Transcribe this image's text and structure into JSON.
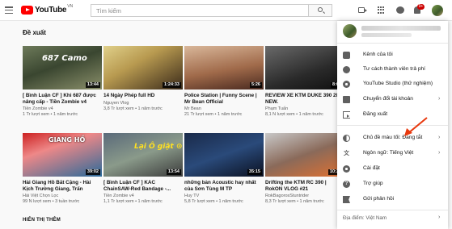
{
  "header": {
    "logo_text": "YouTube",
    "logo_country": "VN",
    "search_placeholder": "Tìm kiếm",
    "notification_count": "9+"
  },
  "feed": {
    "section_title": "Đề xuất",
    "bottom_label": "HIỂN THỊ THÊM",
    "videos": [
      {
        "title": "[ Bình Luận CF ] Khi 687 được nâng cấp - Tiền Zombie v4",
        "channel": "Tiền Zombie v4",
        "meta": "1 Tr lượt xem • 1 năm trước",
        "duration": "13:44",
        "thumb_text": "687 Camo"
      },
      {
        "title": "14 Ngày Phép full HD",
        "channel": "Nguyen Vlog",
        "meta": "3,8 Tr lượt xem • 1 năm trước",
        "duration": "1:24:33",
        "thumb_text": ""
      },
      {
        "title": "Police Station | Funny Scene | Mr Bean Official",
        "channel": "Mr Bean",
        "meta": "21 Tr lượt xem • 1 năm trước",
        "duration": "5:26",
        "thumb_text": ""
      },
      {
        "title": "REVIEW XE KTM DUKE 390 2018 NEW.",
        "channel": "Phạm Tuấn",
        "meta": "8,1 N lượt xem • 1 năm trước",
        "duration": "8:01",
        "thumb_text": ""
      },
      {
        "title": "Hài Giang Hồ Bắt Cặng - Hài Kịch Trường Giang, Trấn Thành...",
        "channel": "Hài Việt Chọn Lọc",
        "meta": "99 N lượt xem • 3 tuần trước",
        "duration": "39:02",
        "thumb_text": "GIANG HỒ"
      },
      {
        "title": "[ Bình Luận CF ] KAC ChainSAW-Red Bandage -...",
        "channel": "Tiền Zombie v4",
        "meta": "1,1 Tr lượt xem • 1 năm trước",
        "duration": "13:54",
        "thumb_text": "Lại Ô giật ⊙"
      },
      {
        "title": "những bản Acoustic hay nhất của Sơn Tùng M TP",
        "channel": "Huy TV",
        "meta": "5,8 Tr lượt xem • 1 năm trước",
        "duration": "35:15",
        "thumb_text": ""
      },
      {
        "title": "Drifting the KTM RC 390 | RokON VLOG #21",
        "channel": "RokBagorosStuntrider",
        "meta": "8,3 Tr lượt xem • 1 năm trước",
        "duration": "10:30",
        "thumb_text": ""
      }
    ]
  },
  "account_menu": {
    "user_name": "█████████████",
    "user_email": "███████",
    "items": [
      {
        "label": "Kênh của tôi",
        "icon": "person-icon",
        "chevron": false
      },
      {
        "label": "Tư cách thành viên trả phí",
        "icon": "dollar-icon",
        "chevron": false
      },
      {
        "label": "YouTube Studio (thử nghiệm)",
        "icon": "gear-icon",
        "chevron": false
      },
      {
        "label": "Chuyển đổi tài khoản",
        "icon": "switch-account-icon",
        "chevron": true
      },
      {
        "label": "Đăng xuất",
        "icon": "sign-out-icon",
        "chevron": false
      },
      {
        "label": "Chủ đề màu tối: Đang tắt",
        "icon": "dark-theme-icon",
        "chevron": true
      },
      {
        "label": "Ngôn ngữ: Tiếng Việt",
        "icon": "translate-icon",
        "chevron": true
      },
      {
        "label": "Cài đặt",
        "icon": "settings-icon",
        "chevron": false
      },
      {
        "label": "Trợ giúp",
        "icon": "help-icon",
        "chevron": false
      },
      {
        "label": "Gửi phản hồi",
        "icon": "feedback-icon",
        "chevron": false
      }
    ],
    "footer": "Địa điểm: Việt Nam",
    "chevron_glyph": "›"
  },
  "colors": {
    "accent": "#ff0000",
    "annotation_arrow": "#e8380d"
  }
}
